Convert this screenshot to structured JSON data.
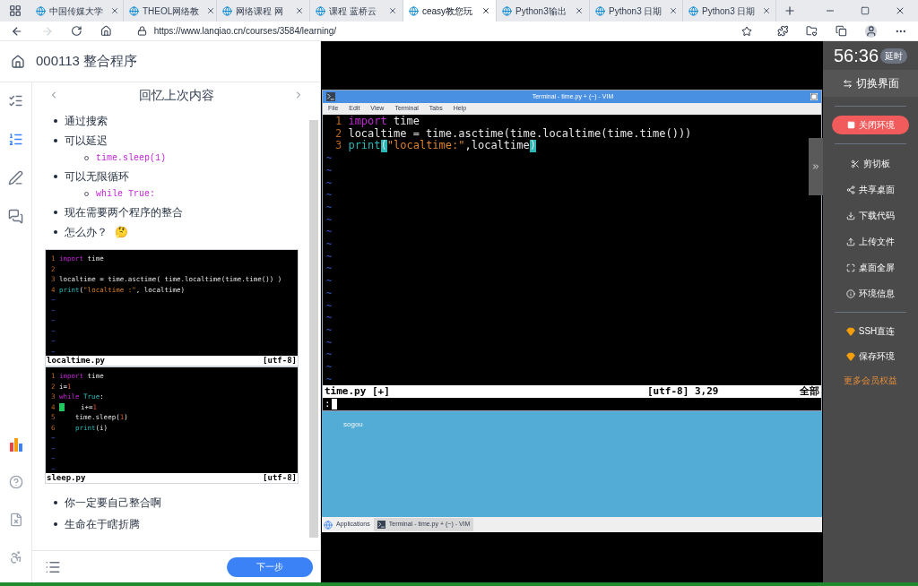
{
  "browser": {
    "tabs": [
      {
        "title": "中国传媒大学",
        "selected": false
      },
      {
        "title": "THEOL网络教",
        "selected": false
      },
      {
        "title": "网络课程 网",
        "selected": false
      },
      {
        "title": "课程 蓝桥云",
        "selected": false
      },
      {
        "title": "ceasy教您玩",
        "selected": true
      },
      {
        "title": "Python3输出",
        "selected": false
      },
      {
        "title": "Python3 日期",
        "selected": false
      },
      {
        "title": "Python3 日期",
        "selected": false
      }
    ],
    "url": "https://www.lanqiao.cn/courses/3584/learning/"
  },
  "course": {
    "title": "000113 整合程序",
    "rail": [
      {
        "selected": false
      },
      {
        "selected": true
      },
      {
        "selected": false
      },
      {
        "selected": false
      }
    ],
    "section_title": "回忆上次内容",
    "bullets_top": [
      {
        "text": "通过搜索"
      },
      {
        "text": "可以延迟",
        "sub": "time.sleep(1)"
      },
      {
        "text": "可以无限循环",
        "sub": "while True:"
      },
      {
        "text": "现在需要两个程序的整合"
      },
      {
        "text": "怎么办？"
      }
    ],
    "emoji": "🤔",
    "snippets": [
      {
        "file": "localtime.py",
        "encoding": "[utf-8]",
        "lines": [
          {
            "cursor": false,
            "segs": [
              {
                "t": "1",
                "kind": "num"
              },
              {
                "t": "import",
                "kind": "kw"
              },
              {
                "t": "time",
                "kind": "plain"
              }
            ]
          },
          {
            "cursor": false,
            "segs": [
              {
                "t": "2",
                "kind": "num"
              }
            ]
          },
          {
            "cursor": false,
            "segs": [
              {
                "t": "3",
                "kind": "num"
              },
              {
                "t": "localtime = time.asctime( time.localtime(time.time()) )",
                "kind": "plain"
              }
            ]
          },
          {
            "cursor": false,
            "segs": [
              {
                "t": "4",
                "kind": "num"
              },
              {
                "t": "print",
                "kind": "fn"
              },
              {
                "t": "(",
                "kind": "plain"
              },
              {
                "t": "\"localtime :\"",
                "kind": "str"
              },
              {
                "t": ", localtime)",
                "kind": "plain"
              }
            ]
          }
        ],
        "tildes": [
          "~",
          "~",
          "~",
          "~",
          "~",
          "~"
        ]
      },
      {
        "file": "sleep.py",
        "encoding": "[utf-8]",
        "lines": [
          {
            "cursor": false,
            "segs": [
              {
                "t": "1",
                "kind": "num"
              },
              {
                "t": "import",
                "kind": "kw"
              },
              {
                "t": "time",
                "kind": "plain"
              }
            ]
          },
          {
            "cursor": false,
            "segs": [
              {
                "t": "2",
                "kind": "num"
              },
              {
                "t": "i=",
                "kind": "plain"
              },
              {
                "t": "1",
                "kind": "lit"
              }
            ]
          },
          {
            "cursor": false,
            "segs": [
              {
                "t": "3",
                "kind": "num"
              },
              {
                "t": "while",
                "kind": "kw"
              },
              {
                "t": "True",
                "kind": "fn"
              },
              {
                "t": ":",
                "kind": "plain"
              }
            ]
          },
          {
            "cursor": true,
            "segs": [
              {
                "t": "4",
                "kind": "num"
              },
              {
                "t": "i+=",
                "kind": "indent"
              },
              {
                "t": "1",
                "kind": "lit"
              }
            ]
          },
          {
            "cursor": false,
            "segs": [
              {
                "t": "5",
                "kind": "num"
              },
              {
                "t": "time.sleep(",
                "kind": "indent"
              },
              {
                "t": "1",
                "kind": "lit"
              },
              {
                "t": ")",
                "kind": "plain"
              }
            ]
          },
          {
            "cursor": false,
            "segs": [
              {
                "t": "6",
                "kind": "num"
              },
              {
                "t": "print",
                "kind": "fnindent"
              },
              {
                "t": "(i)",
                "kind": "plain"
              }
            ]
          }
        ],
        "tildes": [
          "~",
          "~",
          "~",
          "~"
        ]
      }
    ],
    "bullets_bottom": [
      {
        "text": "你一定要自己整合啊"
      },
      {
        "text": "生命在于瞎折腾"
      }
    ],
    "next_button": "下一步"
  },
  "vim": {
    "title": "Terminal - time.py + (~) - VIM",
    "menu": [
      "File",
      "Edit",
      "View",
      "Terminal",
      "Tabs",
      "Help"
    ],
    "lines": [
      [
        {
          "t": "1",
          "kind": "num"
        },
        {
          "t": "import",
          "kind": "kw"
        },
        {
          "t": "time",
          "kind": "plain"
        }
      ],
      [
        {
          "t": "2",
          "kind": "num"
        },
        {
          "t": "localtime = time.asctime(time.localtime(time.time()))",
          "kind": "plain"
        }
      ],
      [
        {
          "t": "3",
          "kind": "num"
        },
        {
          "t": "print",
          "kind": "fn"
        },
        {
          "t": "(",
          "kind": "match"
        },
        {
          "t": "\"localtime:\"",
          "kind": "str"
        },
        {
          "t": ",localtime",
          "kind": "plain"
        },
        {
          "t": ")",
          "kind": "match"
        }
      ]
    ],
    "tildes": [
      "~",
      "~",
      "~",
      "~",
      "~",
      "~",
      "~",
      "~",
      "~",
      "~",
      "~",
      "~",
      "~",
      "~",
      "~",
      "~",
      "~",
      "~",
      "~"
    ],
    "status_file": "time.py [+]",
    "status_pos": "[utf-8] 3,29",
    "status_scope": "全部",
    "command": ":",
    "desktop_icon": "sogou",
    "taskbar": {
      "applications": "Applications",
      "window": "Terminal - time.py + (~) - VIM"
    }
  },
  "side": {
    "timer": "56:36",
    "extend": "延时",
    "switch": "切换界面",
    "close": "关闭环境",
    "tools": [
      {
        "label": "剪切板",
        "kind": "tool"
      },
      {
        "label": "共享桌面",
        "kind": "tool"
      },
      {
        "label": "下载代码",
        "kind": "tool"
      },
      {
        "label": "上传文件",
        "kind": "tool"
      },
      {
        "label": "桌面全屏",
        "kind": "tool"
      },
      {
        "label": "环境信息",
        "kind": "tool"
      }
    ],
    "member": [
      {
        "label": "SSH直连",
        "kind": "gem"
      },
      {
        "label": "保存环境",
        "kind": "gem"
      },
      {
        "label": "更多会员权益",
        "kind": "link"
      }
    ]
  }
}
